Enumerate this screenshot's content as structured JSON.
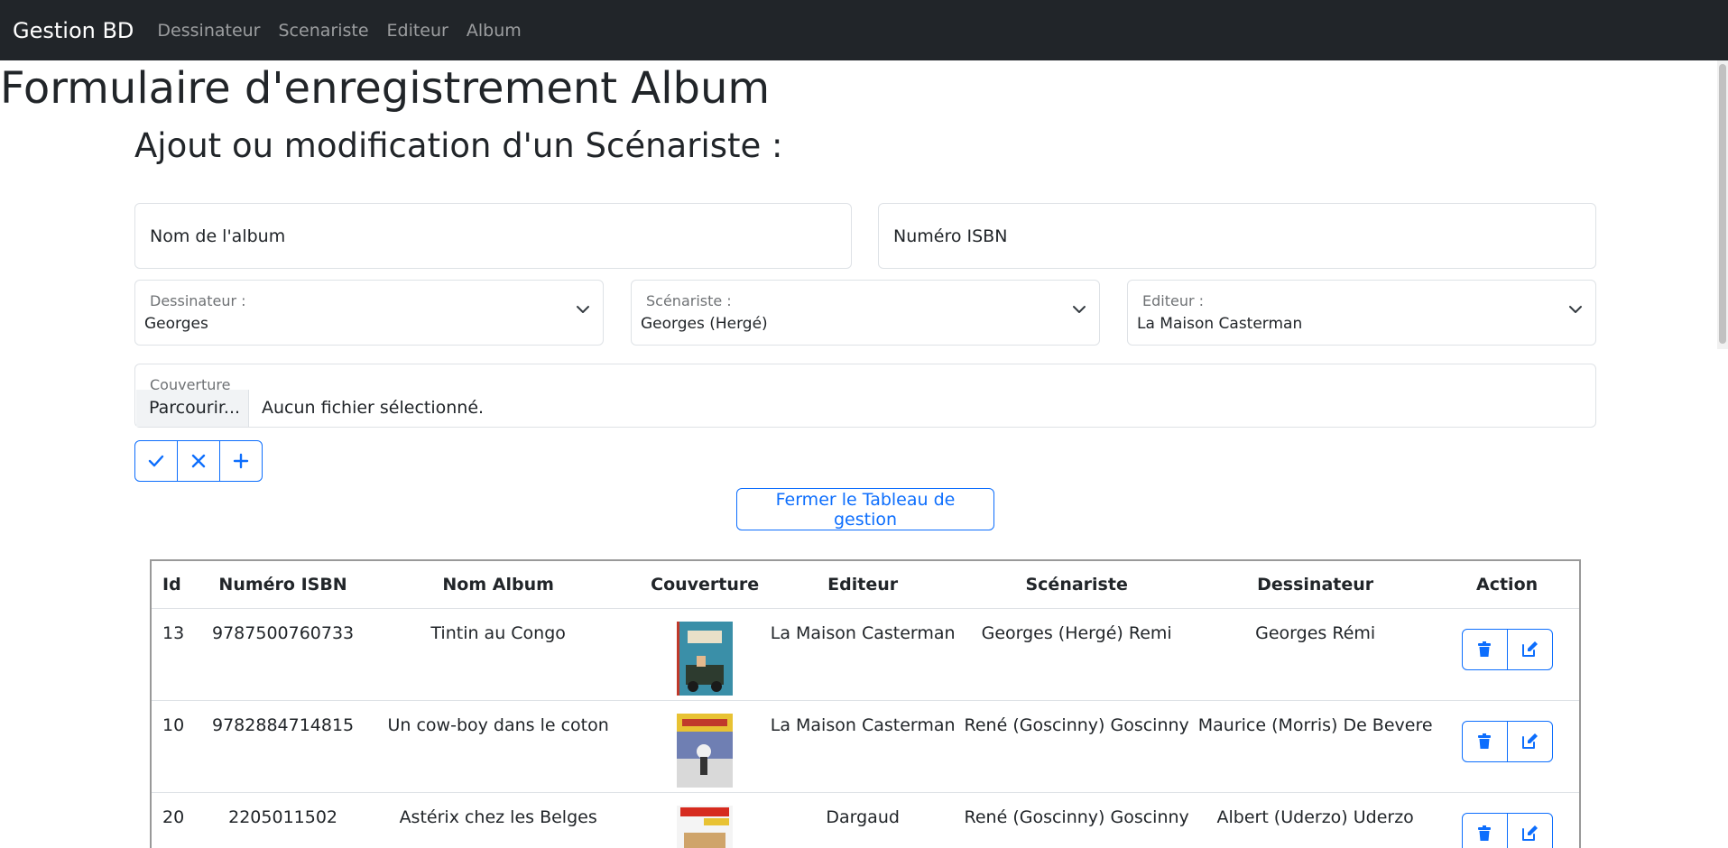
{
  "navbar": {
    "brand": "Gestion BD",
    "links": [
      "Dessinateur",
      "Scenariste",
      "Editeur",
      "Album"
    ]
  },
  "page_title": "Formulaire d'enregistrement Album",
  "subtitle": "Ajout ou modification d'un Scénariste :",
  "form": {
    "album_name": {
      "value": "",
      "placeholder": "Nom de l'album"
    },
    "isbn": {
      "value": "",
      "placeholder": "Numéro ISBN"
    },
    "dessinateur": {
      "label": "Dessinateur :",
      "value": "Georges"
    },
    "scenariste": {
      "label": "Scénariste :",
      "value": "Georges (Hergé)"
    },
    "editeur": {
      "label": "Editeur :",
      "value": "La Maison Casterman"
    },
    "couverture": {
      "label": "Couverture",
      "browse": "Parcourir...",
      "status": "Aucun fichier sélectionné."
    },
    "buttons": {
      "confirm": "check-icon",
      "cancel": "x-icon",
      "add": "plus-icon"
    }
  },
  "close_button": "Fermer le Tableau de gestion",
  "table": {
    "headers": [
      "Id",
      "Numéro ISBN",
      "Nom Album",
      "Couverture",
      "Editeur",
      "Scénariste",
      "Dessinateur",
      "Action"
    ],
    "rows": [
      {
        "id": "13",
        "isbn": "9787500760733",
        "name": "Tintin au Congo",
        "editeur": "La Maison Casterman",
        "scenariste": "Georges (Hergé) Remi",
        "dessinateur": "Georges Rémi"
      },
      {
        "id": "10",
        "isbn": "9782884714815",
        "name": "Un cow-boy dans le coton",
        "editeur": "La Maison Casterman",
        "scenariste": "René (Goscinny) Goscinny",
        "dessinateur": "Maurice (Morris) De Bevere"
      },
      {
        "id": "20",
        "isbn": "2205011502",
        "name": "Astérix chez les Belges",
        "editeur": "Dargaud",
        "scenariste": "René (Goscinny) Goscinny",
        "dessinateur": "Albert (Uderzo) Uderzo"
      }
    ]
  },
  "colors": {
    "navbar": "#212529",
    "primary": "#0d6efd",
    "text": "#212529",
    "border": "#dee2e6"
  }
}
